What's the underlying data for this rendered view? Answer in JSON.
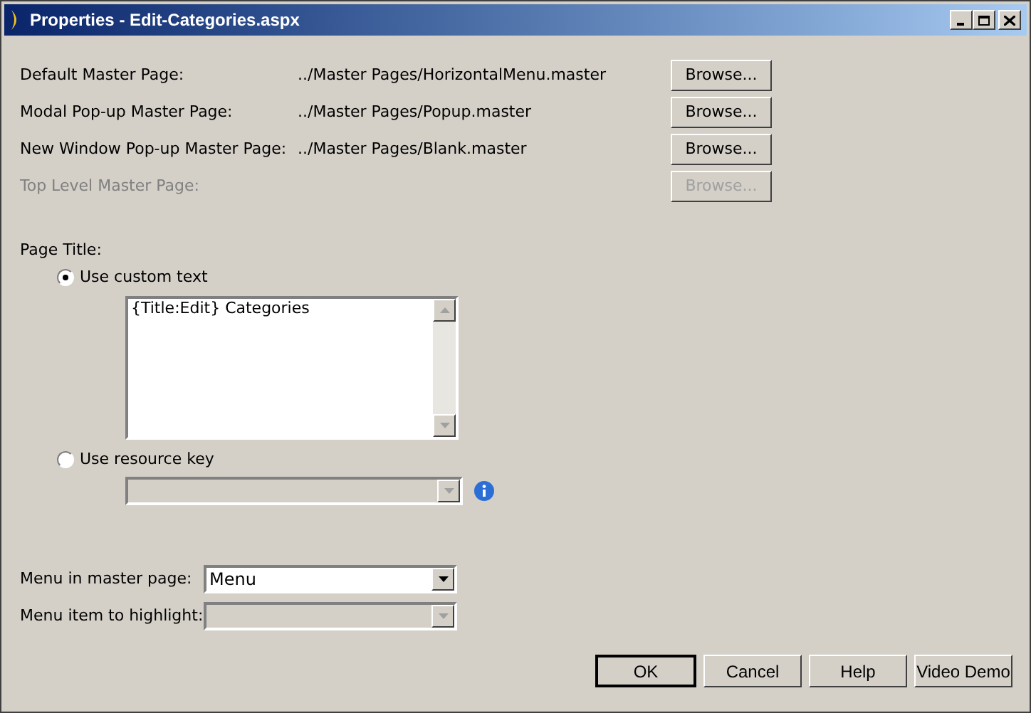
{
  "window": {
    "title": "Properties - Edit-Categories.aspx"
  },
  "master_pages": [
    {
      "label": "Default Master Page:",
      "path": "../Master Pages/HorizontalMenu.master",
      "button": "Browse...",
      "disabled": false
    },
    {
      "label": "Modal Pop-up Master Page:",
      "path": "../Master Pages/Popup.master",
      "button": "Browse...",
      "disabled": false
    },
    {
      "label": "New Window Pop-up Master Page:",
      "path": "../Master Pages/Blank.master",
      "button": "Browse...",
      "disabled": false
    },
    {
      "label": "Top Level Master Page:",
      "button": "Browse...",
      "disabled": true
    }
  ],
  "page_title": {
    "label": "Page Title:",
    "options": [
      {
        "label": "Use custom text",
        "selected": true
      },
      {
        "label": "Use resource key",
        "selected": false
      }
    ],
    "custom_text": {
      "value": "{Title:Edit} Categories"
    },
    "resource_key": {
      "disabled": true
    }
  },
  "menu": [
    {
      "label": "Menu in master page:",
      "value": "Menu",
      "disabled": false
    },
    {
      "label": "Menu item to highlight:",
      "disabled": true
    }
  ],
  "buttons": [
    {
      "label": "OK",
      "default": true
    },
    {
      "label": "Cancel",
      "default": false
    },
    {
      "label": "Help",
      "default": false
    },
    {
      "label": "Video Demo",
      "default": false
    }
  ]
}
